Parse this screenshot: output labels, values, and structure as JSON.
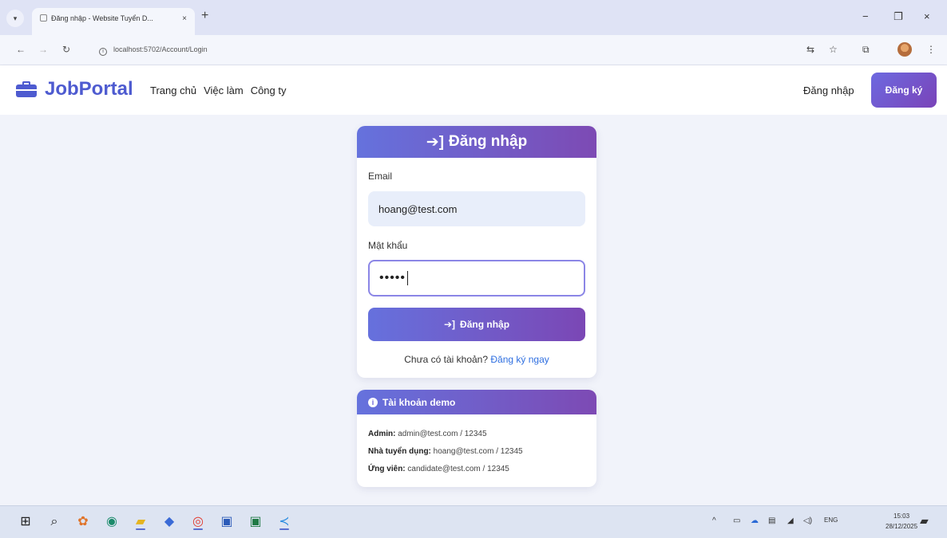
{
  "browser": {
    "tab_title": "Đăng nhập - Website Tuyển D...",
    "tab_close": "×",
    "new_tab": "+",
    "url": "localhost:5702/Account/Login",
    "window_controls": {
      "minimize": "−",
      "maximize": "❐",
      "close": "×"
    }
  },
  "navbar": {
    "brand": "JobPortal",
    "links": [
      "Trang chủ",
      "Việc làm",
      "Công ty"
    ],
    "login": "Đăng nhập",
    "register": "Đăng ký"
  },
  "login": {
    "title": "Đăng nhập",
    "email_label": "Email",
    "email_value": "hoang@test.com",
    "password_label": "Mật khẩu",
    "password_value": "•••••",
    "submit": "Đăng nhập",
    "no_account": "Chưa có tài khoản?",
    "register_link": "Đăng ký ngay"
  },
  "demo": {
    "title": "Tài khoản demo",
    "accounts": [
      {
        "role": "Admin:",
        "cred": "admin@test.com / 12345"
      },
      {
        "role": "Nhà tuyển dụng:",
        "cred": "hoang@test.com / 12345"
      },
      {
        "role": "Ứng viên:",
        "cred": "candidate@test.com / 12345"
      }
    ]
  },
  "taskbar": {
    "language": "ENG",
    "time": "15:03",
    "date": "28/12/2025"
  },
  "colors": {
    "brand": "#4e5bd0",
    "gradient_start": "#6572dd",
    "gradient_end": "#7d4ab4",
    "link": "#2f6fe0",
    "page_bg": "#f1f3fa"
  }
}
